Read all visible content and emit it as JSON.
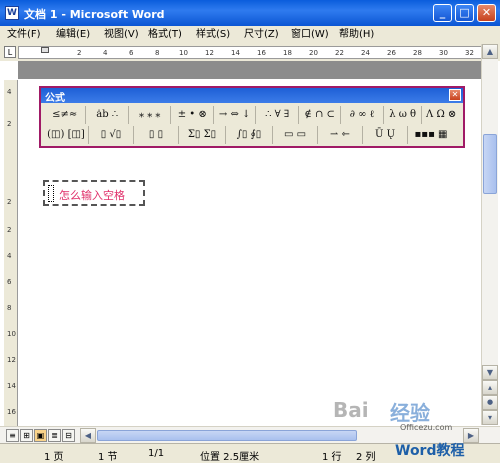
{
  "window": {
    "title": "文档 1 - Microsoft Word",
    "app_icon": "W",
    "min_icon": "_",
    "max_icon": "□",
    "close_icon": "✕"
  },
  "menubar": [
    "文件(F)",
    "编辑(E)",
    "视图(V)",
    "格式(T)",
    "样式(S)",
    "尺寸(Z)",
    "窗口(W)",
    "帮助(H)"
  ],
  "ruler": {
    "corner": "L",
    "h_ticks": [
      "2",
      "4",
      "6",
      "8",
      "10",
      "12",
      "14",
      "16",
      "18",
      "20",
      "22",
      "24",
      "26",
      "28",
      "30",
      "32"
    ],
    "v_ticks": [
      "4",
      "2",
      "2",
      "2",
      "4",
      "6",
      "8",
      "10",
      "12",
      "14",
      "16"
    ]
  },
  "equation_toolbar": {
    "title": "公式",
    "close_icon": "✕",
    "row1": [
      "≤≠≈",
      "ȧb ∴",
      "⁎ ⁎ ⁎",
      "± • ⊗",
      "→ ⇔ ↓",
      "∴ ∀ ∃",
      "∉ ∩ ⊂",
      "∂ ∞ ℓ",
      "λ ω θ",
      "Λ Ω ⊗"
    ],
    "row2": [
      "(◫) [◫]",
      "▯ √▯",
      "▯ ▯",
      "Σ▯ Σ▯",
      "∫▯ ∮▯",
      "▭ ▭",
      "⇀ ⇽",
      "Ū Ų",
      "▪▪▪ ▦"
    ]
  },
  "document": {
    "textbox_text": "怎么输入空格"
  },
  "statusbar": {
    "page": "1 页",
    "section": "1 节",
    "page_of": "1/1",
    "position": "位置 2.5厘米",
    "line": "1 行",
    "column": "2 列"
  },
  "watermark": {
    "baidu": "Bai",
    "jingyan": "经验",
    "site": "Officezu.com",
    "brand": "Word教程"
  },
  "colors": {
    "titlebar": "#2f7bef",
    "toolbar_border": "#a01a66",
    "textbox_text": "#e0306a"
  }
}
